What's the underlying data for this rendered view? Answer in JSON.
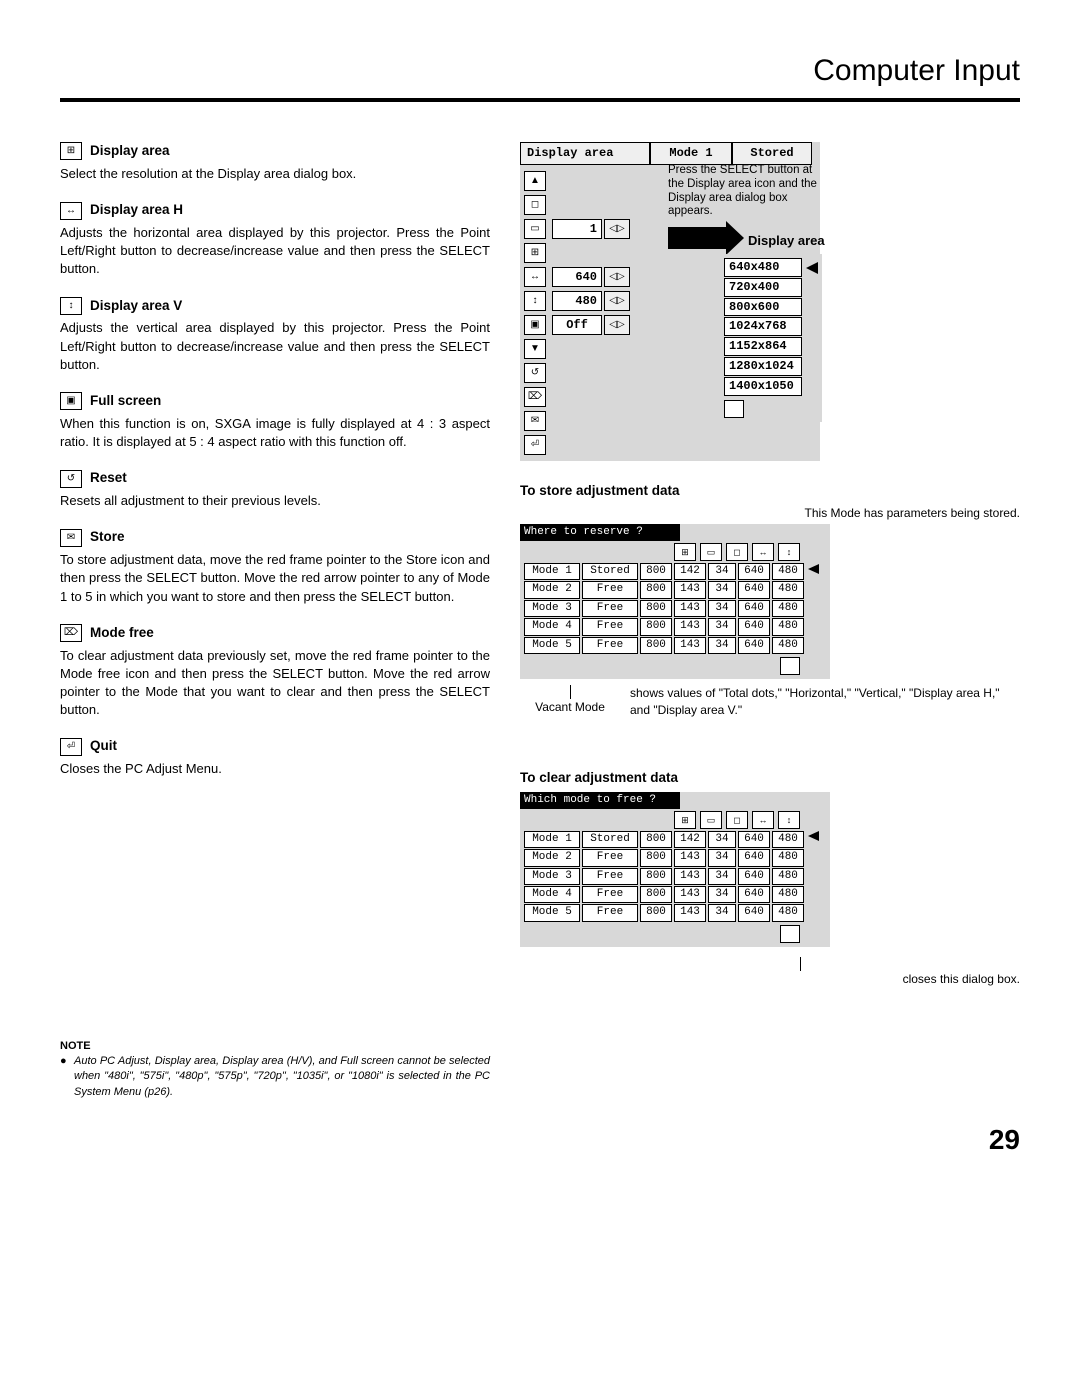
{
  "page": {
    "title": "Computer Input",
    "number": "29"
  },
  "sections": [
    {
      "icon": "⊞",
      "title": "Display area",
      "body": "Select the resolution at the Display area dialog box."
    },
    {
      "icon": "↔",
      "title": "Display area H",
      "body": "Adjusts the horizontal area displayed by this projector.  Press the Point Left/Right button to decrease/increase value and then press the SELECT button."
    },
    {
      "icon": "↕",
      "title": "Display area V",
      "body": "Adjusts the vertical area displayed by this projector.  Press the Point Left/Right button to decrease/increase value and then press the SELECT button."
    },
    {
      "icon": "▣",
      "title": "Full screen",
      "body": "When this function is on, SXGA image is fully displayed at 4 : 3 aspect ratio.  It is displayed at 5 : 4 aspect ratio with this function off."
    },
    {
      "icon": "↺",
      "title": "Reset",
      "body": "Resets all adjustment to their previous levels."
    },
    {
      "icon": "✉",
      "title": "Store",
      "body": "To store adjustment data, move the red frame pointer to the Store icon and then press the SELECT button.  Move the red arrow pointer to any of Mode 1 to 5 in which you want to store  and then press the SELECT button."
    },
    {
      "icon": "⌦",
      "title": "Mode free",
      "body": "To clear adjustment data previously set, move the red frame pointer to the Mode free icon and then press the SELECT button.  Move the red arrow pointer to the Mode that you want to clear and then press the SELECT button."
    },
    {
      "icon": "⏎",
      "title": "Quit",
      "body": "Closes the PC Adjust Menu."
    }
  ],
  "note": {
    "label": "NOTE",
    "body": "Auto PC Adjust, Display area, Display area (H/V), and Full screen cannot be selected when \"480i\", \"575i\", \"480p\", \"575p\", \"720p\", \"1035i\", or \"1080i\" is selected in the PC System Menu (p26)."
  },
  "panel": {
    "title": "Display area",
    "mode": "Mode 1",
    "status": "Stored",
    "callout": "Press the SELECT button at the Display area icon and the Display area dialog box appears.",
    "disp_label": "Display area",
    "values": {
      "top": "1",
      "h": "640",
      "v": "480",
      "full": "Off"
    },
    "resolutions": [
      "640x480",
      "720x400",
      "800x600",
      "1024x768",
      "1152x864",
      "1280x1024",
      "1400x1050"
    ]
  },
  "store_section": {
    "heading": "To store adjustment data",
    "caption": "This Mode has parameters being stored.",
    "prompt": "Where to reserve ?",
    "ann1": "Vacant Mode",
    "ann2": "shows values of \"Total dots,\" \"Horizontal,\" \"Vertical,\" \"Display area H,\" and \"Display area V.\""
  },
  "clear_section": {
    "heading": "To clear adjustment data",
    "prompt": "Which mode to free ?",
    "closes": "closes this dialog box."
  },
  "modes": [
    {
      "name": "Mode 1",
      "status": "Stored",
      "v": [
        "800",
        "142",
        "34",
        "640",
        "480"
      ]
    },
    {
      "name": "Mode 2",
      "status": "Free",
      "v": [
        "800",
        "143",
        "34",
        "640",
        "480"
      ]
    },
    {
      "name": "Mode 3",
      "status": "Free",
      "v": [
        "800",
        "143",
        "34",
        "640",
        "480"
      ]
    },
    {
      "name": "Mode 4",
      "status": "Free",
      "v": [
        "800",
        "143",
        "34",
        "640",
        "480"
      ]
    },
    {
      "name": "Mode 5",
      "status": "Free",
      "v": [
        "800",
        "143",
        "34",
        "640",
        "480"
      ]
    }
  ]
}
